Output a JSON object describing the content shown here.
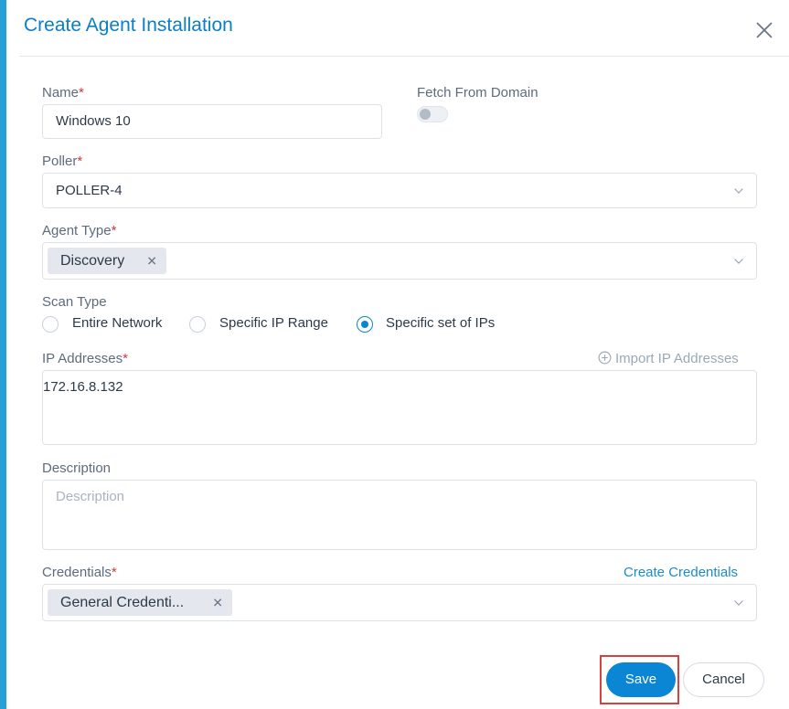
{
  "modal": {
    "title": "Create Agent Installation"
  },
  "form": {
    "name": {
      "label": "Name",
      "required": "*",
      "value": "Windows 10"
    },
    "fetch_from_domain": {
      "label": "Fetch From Domain",
      "enabled": false
    },
    "poller": {
      "label": "Poller",
      "required": "*",
      "value": "POLLER-4"
    },
    "agent_type": {
      "label": "Agent Type",
      "required": "*",
      "tags": [
        "Discovery"
      ]
    },
    "scan_type": {
      "label": "Scan Type",
      "options": [
        "Entire Network",
        "Specific IP Range",
        "Specific set of IPs"
      ],
      "selected": "Specific set of IPs"
    },
    "ip_addresses": {
      "label": "IP Addresses",
      "required": "*",
      "import_link": "Import IP Addresses",
      "value": "172.16.8.132"
    },
    "description": {
      "label": "Description",
      "placeholder": "Description",
      "value": ""
    },
    "credentials": {
      "label": "Credentials",
      "required": "*",
      "create_link": "Create Credentials",
      "tags": [
        "General Credenti..."
      ]
    }
  },
  "actions": {
    "save_label": "Save",
    "cancel_label": "Cancel"
  },
  "colors": {
    "accent": "#0a86d4",
    "title": "#0b7fc4",
    "required": "#d6373a",
    "highlight_frame": "#d9413f"
  }
}
